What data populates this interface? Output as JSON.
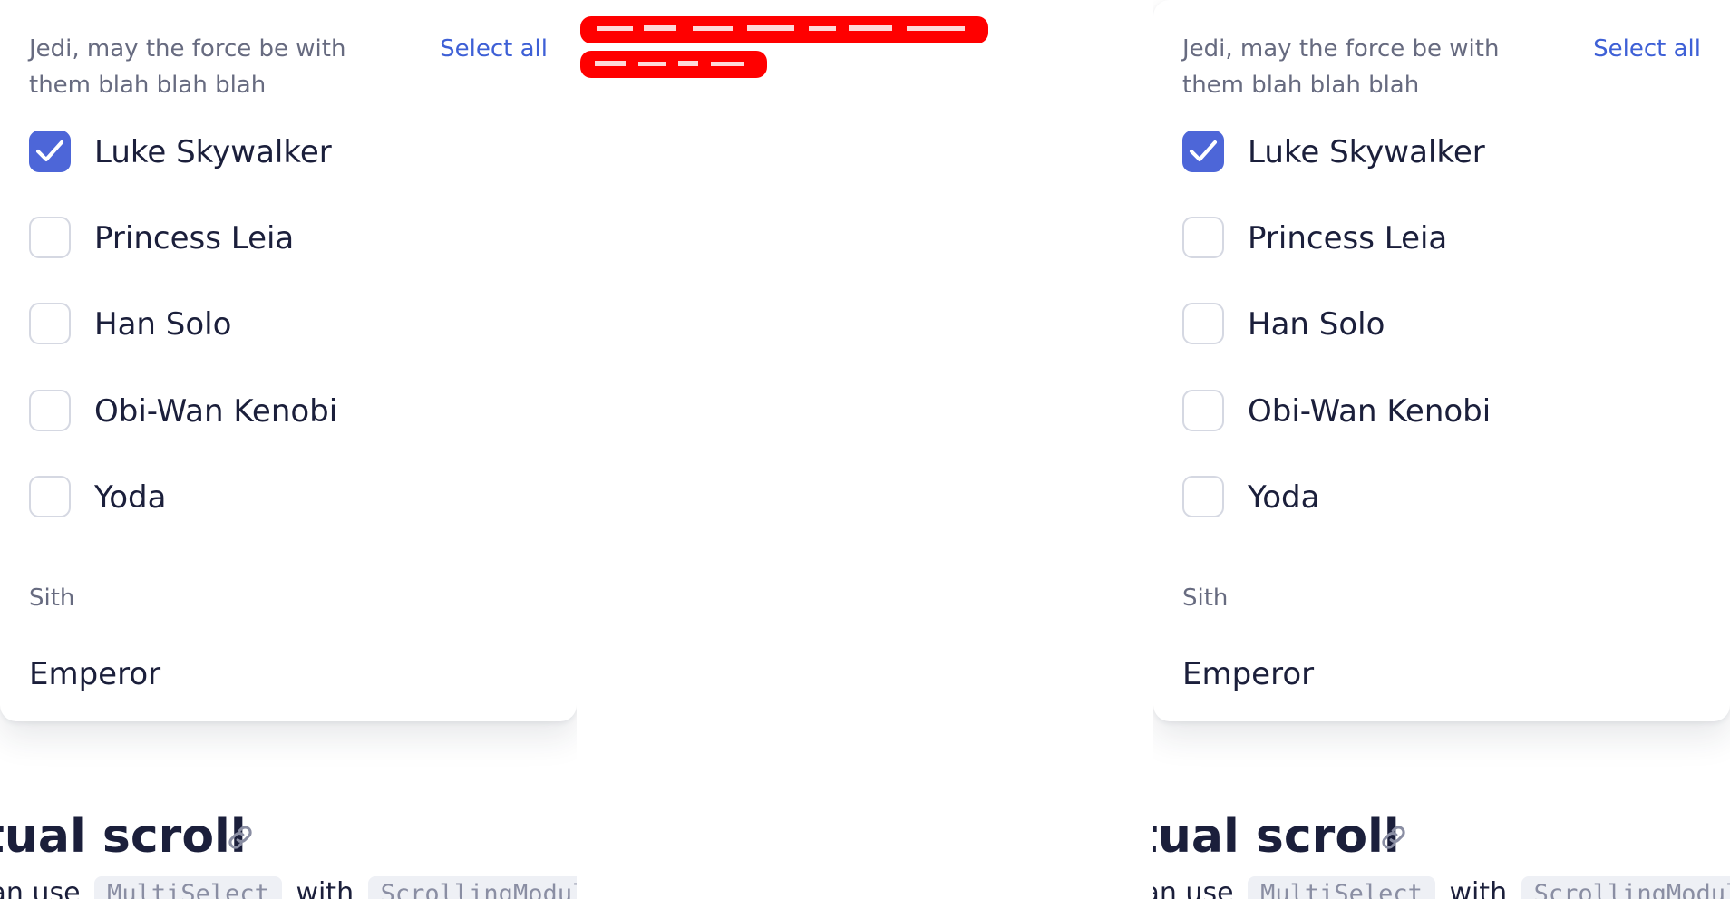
{
  "panes": {
    "left": {
      "group_label": "Jedi, may the force be with them blah blah blah",
      "select_all": "Select all",
      "options": [
        {
          "label": "Luke Skywalker",
          "checked": true
        },
        {
          "label": "Princess Leia",
          "checked": false
        },
        {
          "label": "Han Solo",
          "checked": false
        },
        {
          "label": "Obi-Wan Kenobi",
          "checked": false
        },
        {
          "label": "Yoda",
          "checked": false
        }
      ],
      "sith_title": "Sith",
      "sith_option": "Emperor",
      "heading": "tual scroll",
      "para_prefix": "can use",
      "code_1": "MultiSelect",
      "para_mid": "with",
      "code_2": "ScrollingModule"
    },
    "right": {
      "group_label": "Jedi, may the force be with them blah blah blah",
      "select_all": "Select all",
      "options": [
        {
          "label": "Luke Skywalker",
          "checked": true
        },
        {
          "label": "Princess Leia",
          "checked": false
        },
        {
          "label": "Han Solo",
          "checked": false
        },
        {
          "label": "Obi-Wan Kenobi",
          "checked": false
        },
        {
          "label": "Yoda",
          "checked": false
        }
      ],
      "sith_title": "Sith",
      "sith_option": "Emperor",
      "heading": "tual scroll",
      "para_prefix": "can use",
      "code_1": "MultiSelect",
      "para_mid": "with",
      "code_2": "ScrollingModule"
    }
  },
  "icons": {
    "check": "check-icon",
    "link": "link-icon"
  },
  "colors": {
    "accent": "#4d66d8",
    "link": "#3e60d6",
    "muted_text": "#676b80",
    "text": "#1b1f3b",
    "redaction": "#ff0000"
  }
}
